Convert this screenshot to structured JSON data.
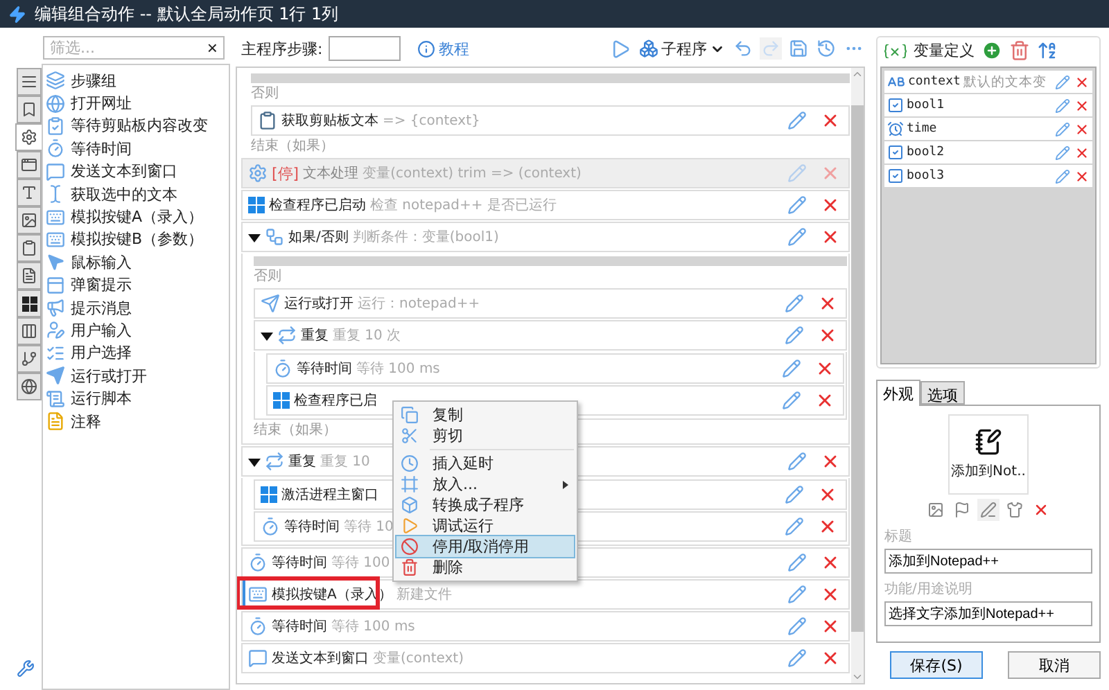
{
  "window": {
    "title": "编辑组合动作 -- 默认全局动作页 1行 1列"
  },
  "filter": {
    "placeholder": "筛选...",
    "clear": "×"
  },
  "side_tabs": [
    {
      "selected": false
    },
    {
      "selected": false
    },
    {
      "selected": true
    },
    {
      "selected": false
    },
    {
      "selected": false
    },
    {
      "selected": false
    },
    {
      "selected": false
    },
    {
      "selected": false
    },
    {
      "selected": false
    },
    {
      "selected": false
    },
    {
      "selected": false
    },
    {
      "selected": false
    }
  ],
  "actions": [
    {
      "kind": "group",
      "label": "步骤组"
    },
    {
      "kind": "url",
      "label": "打开网址"
    },
    {
      "kind": "clipwait",
      "label": "等待剪贴板内容改变"
    },
    {
      "kind": "wait",
      "label": "等待时间"
    },
    {
      "kind": "sendtext",
      "label": "发送文本到窗口"
    },
    {
      "kind": "selection",
      "label": "获取选中的文本"
    },
    {
      "kind": "keys",
      "label": "模拟按键A（录入）"
    },
    {
      "kind": "keys",
      "label": "模拟按键B（参数）"
    },
    {
      "kind": "mouse",
      "label": "鼠标输入"
    },
    {
      "kind": "popup",
      "label": "弹窗提示"
    },
    {
      "kind": "notify",
      "label": "提示消息"
    },
    {
      "kind": "input",
      "label": "用户输入"
    },
    {
      "kind": "choice",
      "label": "用户选择"
    },
    {
      "kind": "run",
      "label": "运行或打开"
    },
    {
      "kind": "script",
      "label": "运行脚本"
    },
    {
      "kind": "note",
      "label": "注释"
    }
  ],
  "toolbar": {
    "steps_label": "主程序步骤:",
    "tutorial": "教程",
    "subprogram": "子程序"
  },
  "steps": [
    {
      "kind": "block",
      "children": [
        {
          "kind": "gap"
        },
        {
          "kind": "label",
          "text": "否则"
        },
        {
          "kind": "clipboard",
          "title": "获取剪贴板文本",
          "detail": "=> {context}"
        },
        {
          "kind": "label",
          "text": "结束（如果）"
        }
      ]
    },
    {
      "kind": "textproc",
      "title": "文本处理",
      "tag": "[停]",
      "detail": "变量(context) trim => (context)",
      "disabled": true
    },
    {
      "kind": "checkprocess",
      "title": "检查程序已启动",
      "detail": "检查 notepad++ 是否已运行"
    },
    {
      "kind": "ifelse",
      "title": "如果/否则",
      "detail": "判断条件：变量(bool1)",
      "expanded": true,
      "children": [
        {
          "kind": "gap"
        },
        {
          "kind": "label",
          "text": "否则"
        },
        {
          "kind": "run",
          "title": "运行或打开",
          "detail": "运行：notepad++"
        },
        {
          "kind": "repeat",
          "title": "重复",
          "detail": "重复 10 次",
          "expanded": true,
          "children": [
            {
              "kind": "wait",
              "title": "等待时间",
              "detail": "等待 100 ms"
            },
            {
              "kind": "checkprocess",
              "title": "检查程序已启"
            }
          ]
        },
        {
          "kind": "label",
          "text": "结束（如果）"
        }
      ]
    },
    {
      "kind": "repeat",
      "title": "重复",
      "detail": "重复 10",
      "expanded": true,
      "children": [
        {
          "kind": "activate",
          "title": "激活进程主窗口"
        },
        {
          "kind": "wait",
          "title": "等待时间",
          "detail": "等待 10"
        }
      ]
    },
    {
      "kind": "wait",
      "title": "等待时间",
      "detail": "等待 100"
    },
    {
      "kind": "keys",
      "title": "模拟按键A（录入）",
      "detail": "新建文件",
      "selected": true
    },
    {
      "kind": "wait",
      "title": "等待时间",
      "detail": "等待 100 ms"
    },
    {
      "kind": "sendtext",
      "title": "发送文本到窗口",
      "detail": "变量(context)"
    }
  ],
  "context_menu": [
    {
      "kind": "command",
      "label": "复制",
      "selected": false
    },
    {
      "kind": "command",
      "label": "剪切",
      "selected": false
    },
    {
      "kind": "separator"
    },
    {
      "kind": "command",
      "label": "插入延时",
      "selected": false
    },
    {
      "kind": "submenu",
      "label": "放入...",
      "selected": false
    },
    {
      "kind": "command",
      "label": "转换成子程序",
      "selected": false
    },
    {
      "kind": "command",
      "label": "调试运行",
      "selected": false
    },
    {
      "kind": "command",
      "label": "停用/取消停用",
      "selected": true
    },
    {
      "kind": "command",
      "label": "删除",
      "selected": false
    }
  ],
  "variables": {
    "title": "变量定义",
    "items": [
      {
        "kind": "text",
        "name": "context",
        "note": "默认的文本变"
      },
      {
        "kind": "bool",
        "name": "bool1"
      },
      {
        "kind": "time",
        "name": "time"
      },
      {
        "kind": "bool",
        "name": "bool2"
      },
      {
        "kind": "bool",
        "name": "bool3"
      }
    ]
  },
  "props_tabs": [
    {
      "label": "外观",
      "selected": true
    },
    {
      "label": "选项",
      "selected": false
    }
  ],
  "appearance": {
    "preview_label": "添加到Not..",
    "title_label": "标题",
    "title_value": "添加到Notepad++",
    "desc_label": "功能/用途说明",
    "desc_value": "选择文字添加到Notepad++"
  },
  "buttons": [
    {
      "label": "保存(S)",
      "primary": true
    },
    {
      "label": "取消",
      "primary": false
    }
  ]
}
